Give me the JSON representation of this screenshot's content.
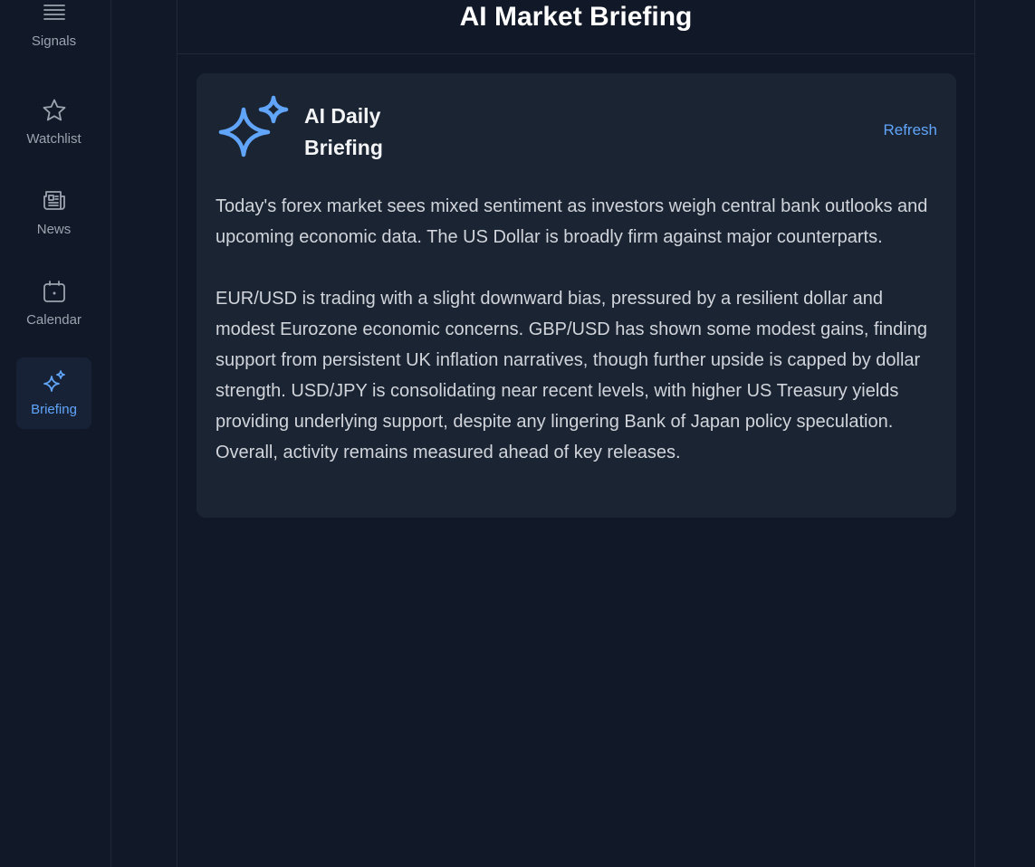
{
  "sidebar": {
    "items": [
      {
        "label": "Signals",
        "icon": "list-icon",
        "active": false
      },
      {
        "label": "Watchlist",
        "icon": "star-icon",
        "active": false
      },
      {
        "label": "News",
        "icon": "newspaper-icon",
        "active": false
      },
      {
        "label": "Calendar",
        "icon": "calendar-icon",
        "active": false
      },
      {
        "label": "Briefing",
        "icon": "sparkles-icon",
        "active": true
      }
    ]
  },
  "header": {
    "title": "AI Market Briefing"
  },
  "briefing": {
    "title": "AI Daily Briefing",
    "refresh_label": "Refresh",
    "paragraphs": [
      "Today's forex market sees mixed sentiment as investors weigh central bank outlooks and upcoming economic data. The US Dollar is broadly firm against major counterparts.",
      "EUR/USD is trading with a slight downward bias, pressured by a resilient dollar and modest Eurozone economic concerns. GBP/USD has shown some modest gains, finding support from persistent UK inflation narratives, though further upside is capped by dollar strength. USD/JPY is consolidating near recent levels, with higher US Treasury yields providing underlying support, despite any lingering Bank of Japan policy speculation. Overall, activity remains measured ahead of key releases."
    ]
  },
  "colors": {
    "background": "#111827",
    "card": "#1b2433",
    "accent": "#60a5fa",
    "active_nav_bg": "#172236",
    "muted_text": "#9ca3af"
  }
}
